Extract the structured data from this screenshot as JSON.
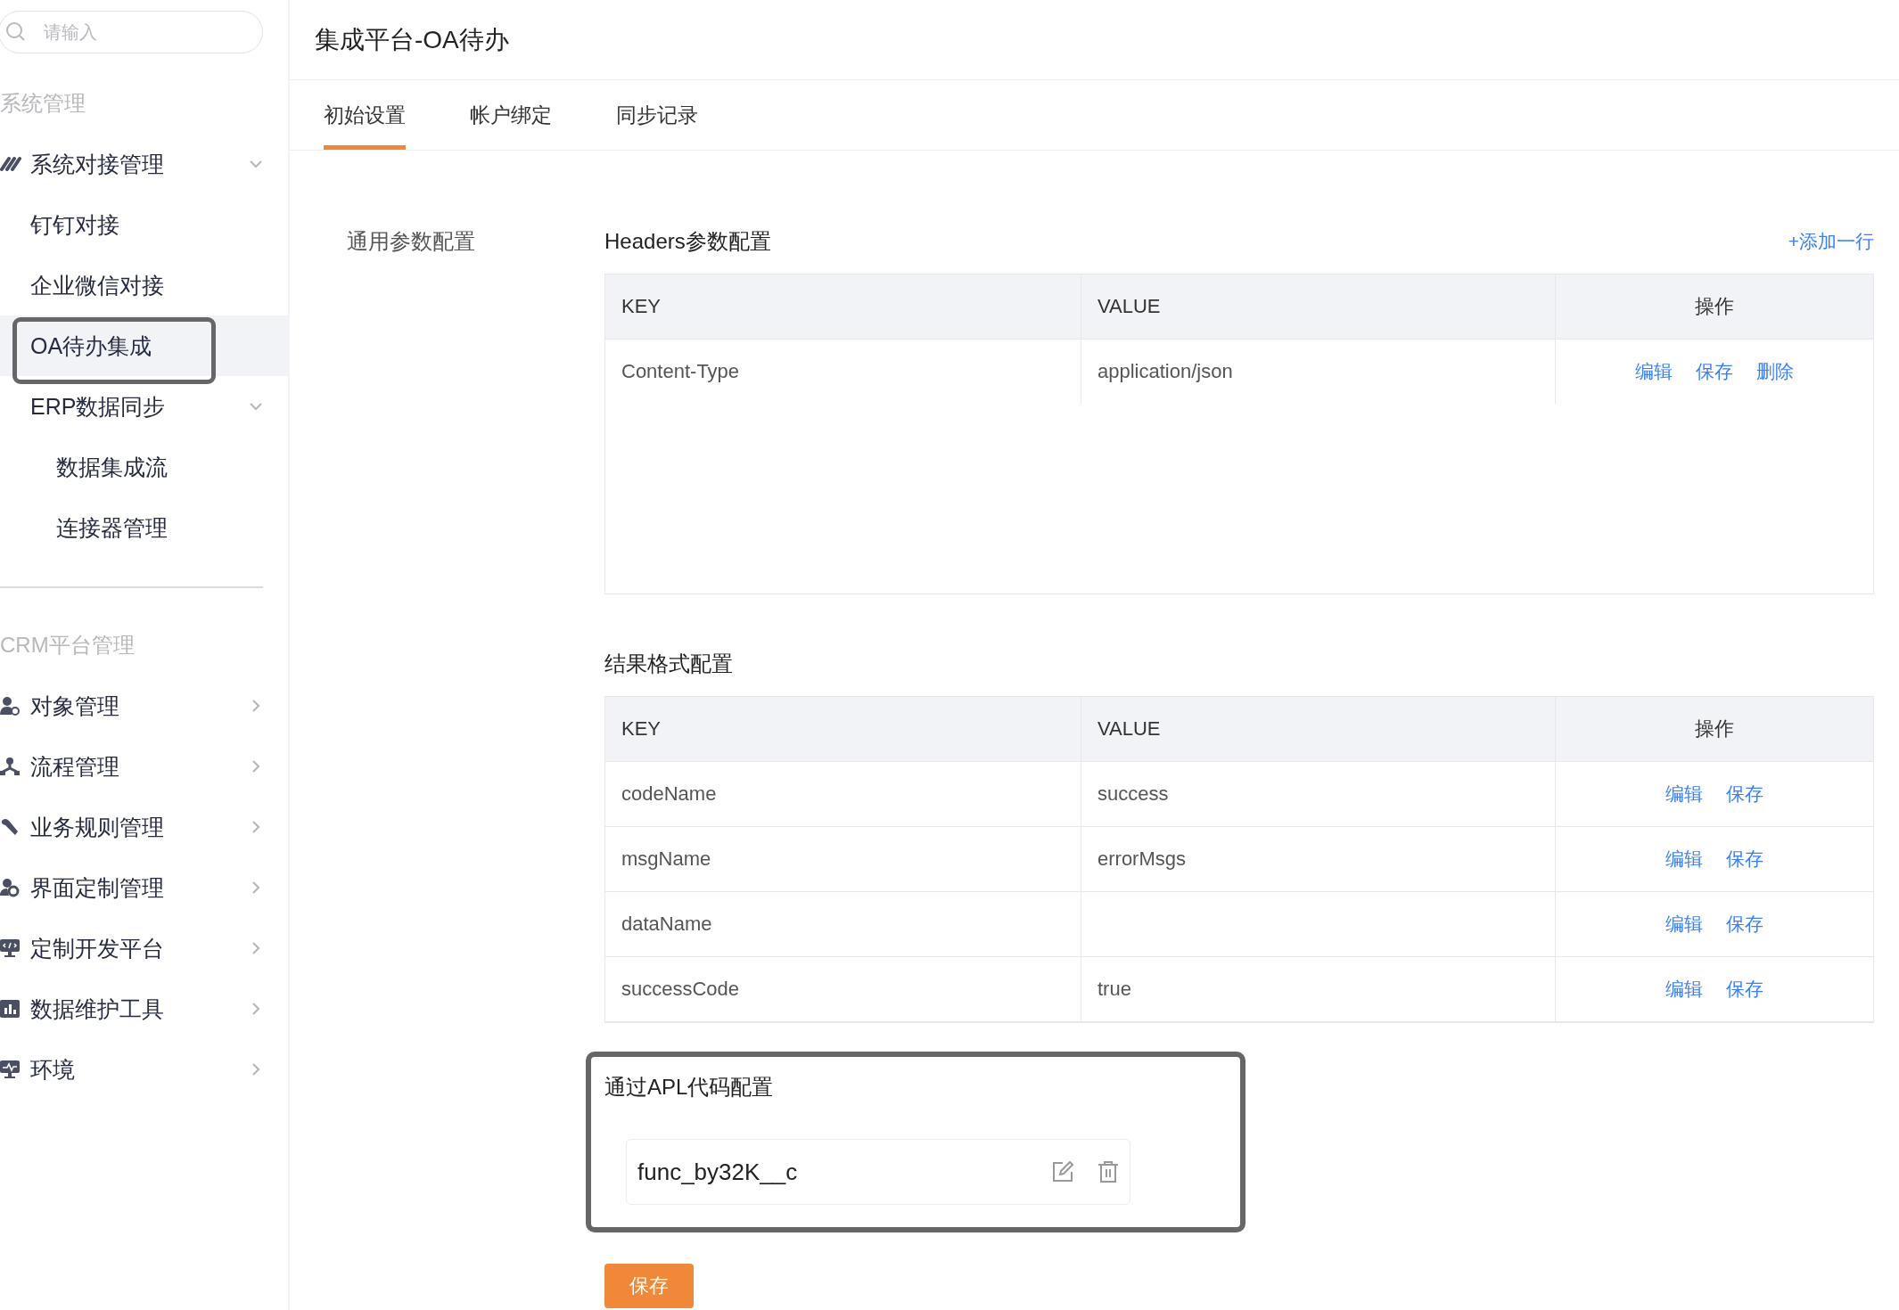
{
  "sidebar": {
    "search": {
      "placeholder": "请输入"
    },
    "sections": [
      {
        "title": "系统管理",
        "items": [
          {
            "label": "系统对接管理",
            "expanded": true,
            "selected": false,
            "nested": false,
            "children": [
              {
                "label": "钉钉对接",
                "selected": false
              },
              {
                "label": "企业微信对接",
                "selected": false
              },
              {
                "label": "OA待办集成",
                "selected": true,
                "highlighted": true
              }
            ]
          },
          {
            "label": "ERP数据同步",
            "expanded": true,
            "selected": false,
            "nested": true,
            "children": [
              {
                "label": "数据集成流",
                "selected": false
              },
              {
                "label": "连接器管理",
                "selected": false
              }
            ]
          }
        ]
      },
      {
        "title": "CRM平台管理",
        "items": [
          {
            "label": "对象管理",
            "expanded": false,
            "selected": false
          },
          {
            "label": "流程管理",
            "expanded": false,
            "selected": false
          },
          {
            "label": "业务规则管理",
            "expanded": false,
            "selected": false
          },
          {
            "label": "界面定制管理",
            "expanded": false,
            "selected": false
          },
          {
            "label": "定制开发平台",
            "expanded": false,
            "selected": false
          },
          {
            "label": "数据维护工具",
            "expanded": false,
            "selected": false
          },
          {
            "label": "环境",
            "expanded": false,
            "selected": false
          }
        ]
      }
    ]
  },
  "page_title": "集成平台-OA待办",
  "tabs": [
    {
      "label": "初始设置",
      "selected": true
    },
    {
      "label": "帐户绑定",
      "selected": false
    },
    {
      "label": "同步记录",
      "selected": false
    }
  ],
  "settings_nav": "通用参数配置",
  "headers_config": {
    "title": "Headers参数配置",
    "add_link": "+添加一行",
    "columns": [
      "KEY",
      "VALUE",
      "操作"
    ],
    "rows": [
      {
        "cells": [
          "Content-Type",
          "application/json"
        ],
        "actions": [
          "编辑",
          "保存",
          "删除"
        ]
      }
    ]
  },
  "result_format": {
    "title": "结果格式配置",
    "columns": [
      "KEY",
      "VALUE",
      "操作"
    ],
    "rows": [
      {
        "cells": [
          "codeName",
          "success"
        ],
        "actions": [
          "编辑",
          "保存"
        ]
      },
      {
        "cells": [
          "msgName",
          "errorMsgs"
        ],
        "actions": [
          "编辑",
          "保存"
        ]
      },
      {
        "cells": [
          "dataName",
          ""
        ],
        "actions": [
          "编辑",
          "保存"
        ]
      },
      {
        "cells": [
          "successCode",
          "true"
        ],
        "actions": [
          "编辑",
          "保存"
        ]
      }
    ]
  },
  "apl_config": {
    "title": "通过APL代码配置",
    "highlighted": true,
    "function": "func_by32K__c"
  },
  "save_button": "保存"
}
